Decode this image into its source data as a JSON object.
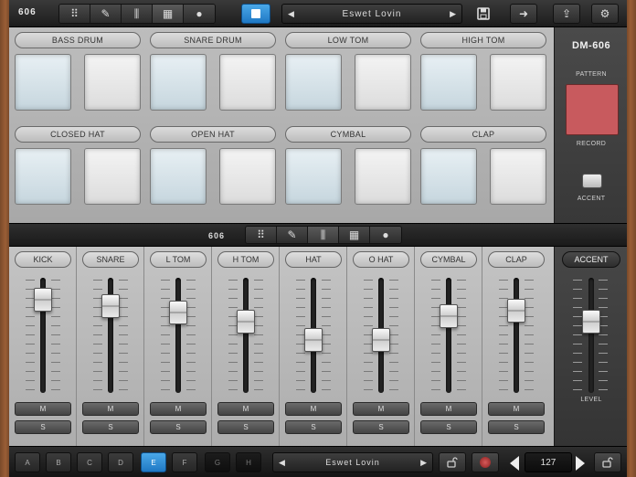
{
  "topbar": {
    "title": "606",
    "tabs": [
      {
        "icon": "grid-icon",
        "glyph": "⠿"
      },
      {
        "icon": "pencil-icon",
        "glyph": "✎"
      },
      {
        "icon": "mixer-icon",
        "glyph": "⫼"
      },
      {
        "icon": "pads-icon",
        "glyph": "▦"
      },
      {
        "icon": "metronome-icon",
        "glyph": "●"
      }
    ],
    "play_icon": "stop-square-icon",
    "pattern_name": "Eswet Lovin",
    "prev_icon": "◀",
    "next_icon": "▶",
    "save_glyph": "💾",
    "export_glyph": "➜",
    "share_glyph": "⇪",
    "settings_glyph": "⚙"
  },
  "pads": [
    {
      "label": "BASS DRUM"
    },
    {
      "label": "SNARE DRUM"
    },
    {
      "label": "LOW TOM"
    },
    {
      "label": "HIGH TOM"
    },
    {
      "label": "CLOSED HAT"
    },
    {
      "label": "OPEN HAT"
    },
    {
      "label": "CYMBAL"
    },
    {
      "label": "CLAP"
    }
  ],
  "right_panel": {
    "model": "DM-606",
    "pattern_label": "PATTERN",
    "record_label": "RECORD",
    "accent_label": "ACCENT",
    "record_color": "#c85a5e"
  },
  "midbar": {
    "title": "606"
  },
  "mixer": {
    "channels": [
      {
        "label": "KICK",
        "level": 0.85,
        "mute": "M",
        "solo": "S"
      },
      {
        "label": "SNARE",
        "level": 0.78,
        "mute": "M",
        "solo": "S"
      },
      {
        "label": "L TOM",
        "level": 0.72,
        "mute": "M",
        "solo": "S"
      },
      {
        "label": "H TOM",
        "level": 0.62,
        "mute": "M",
        "solo": "S"
      },
      {
        "label": "HAT",
        "level": 0.42,
        "mute": "M",
        "solo": "S"
      },
      {
        "label": "O HAT",
        "level": 0.42,
        "mute": "M",
        "solo": "S"
      },
      {
        "label": "CYMBAL",
        "level": 0.68,
        "mute": "M",
        "solo": "S"
      },
      {
        "label": "CLAP",
        "level": 0.74,
        "mute": "M",
        "solo": "S"
      }
    ],
    "accent": {
      "label": "ACCENT",
      "level": 0.62,
      "level_label": "LEVEL"
    }
  },
  "bottombar": {
    "patterns": [
      "A",
      "B",
      "C",
      "D",
      "E",
      "F",
      "G",
      "H"
    ],
    "selected_pattern": "E",
    "pattern_name": "Eswet Lovin",
    "tempo": "127",
    "accent_color": "#2a8fdc"
  }
}
